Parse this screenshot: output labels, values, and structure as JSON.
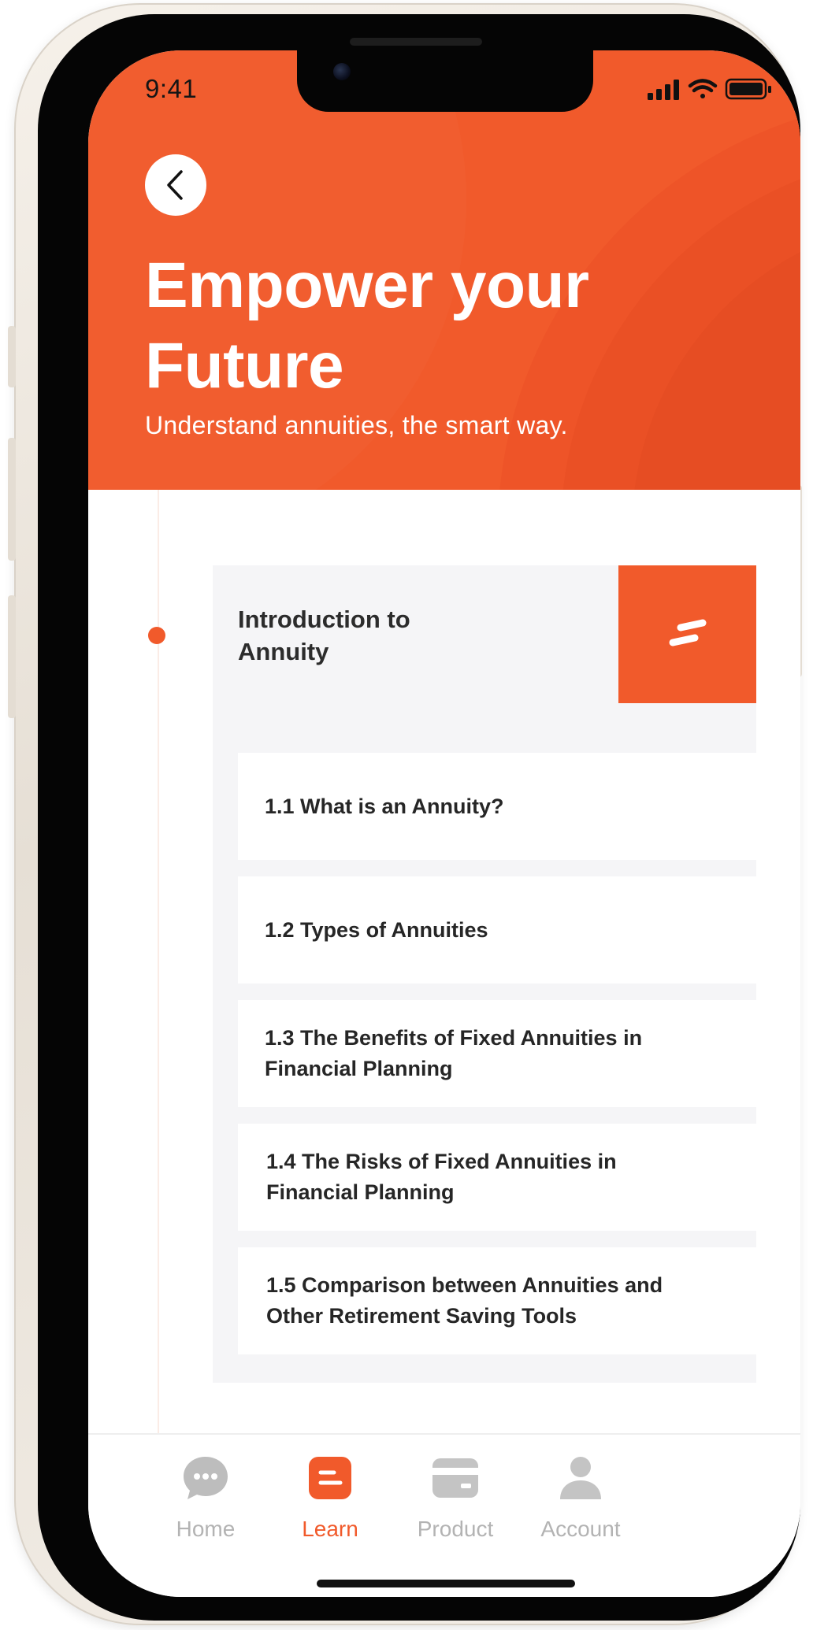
{
  "status_bar": {
    "time": "9:41"
  },
  "header": {
    "title_line1": "Empower your",
    "title_line2": "Future",
    "subtitle": "Understand annuities, the smart way."
  },
  "module": {
    "title_line1": "Introduction to",
    "title_line2": "Annuity",
    "lessons": [
      {
        "line1": "1.1 What is an Annuity?",
        "line2": ""
      },
      {
        "line1": "1.2 Types of Annuities",
        "line2": ""
      },
      {
        "line1": "1.3 The Benefits of Fixed Annuities in",
        "line2": "Financial Planning"
      },
      {
        "line1": "1.4 The Risks of Fixed Annuities in",
        "line2": "Financial Planning"
      },
      {
        "line1": "1.5 Comparison between Annuities and",
        "line2": "Other Retirement Saving Tools"
      }
    ]
  },
  "tabbar": {
    "tabs": [
      {
        "label": "Home",
        "icon": "chat-bubble-icon",
        "active": false
      },
      {
        "label": "Learn",
        "icon": "learn-icon",
        "active": true
      },
      {
        "label": "Product",
        "icon": "card-icon",
        "active": false
      },
      {
        "label": "Account",
        "icon": "person-icon",
        "active": false
      }
    ]
  },
  "colors": {
    "accent": "#f15a2b",
    "inactive_tab": "#b3b3b3",
    "card_bg": "#f5f5f7"
  }
}
